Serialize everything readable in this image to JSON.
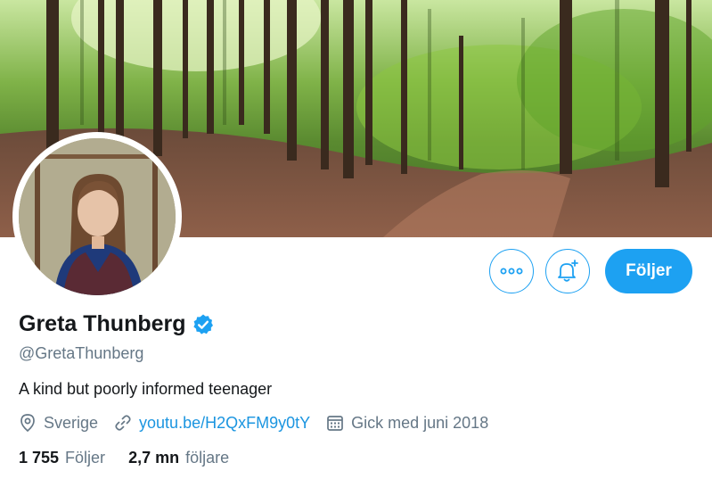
{
  "profile": {
    "display_name": "Greta Thunberg",
    "handle": "@GretaThunberg",
    "bio": "A kind but poorly informed teenager",
    "verified": true,
    "location": "Sverige",
    "website": "youtu.be/H2QxFM9y0tY",
    "joined": "Gick med juni 2018"
  },
  "stats": {
    "following_count": "1 755",
    "following_label": "Följer",
    "followers_count": "2,7 mn",
    "followers_label": "följare"
  },
  "actions": {
    "follow_label": "Följer",
    "more_icon": "more-icon",
    "notify_icon": "bell-plus-icon"
  },
  "colors": {
    "accent": "#1da1f2",
    "link": "#1b95e0",
    "secondary_text": "#657786",
    "primary_text": "#14171a"
  }
}
